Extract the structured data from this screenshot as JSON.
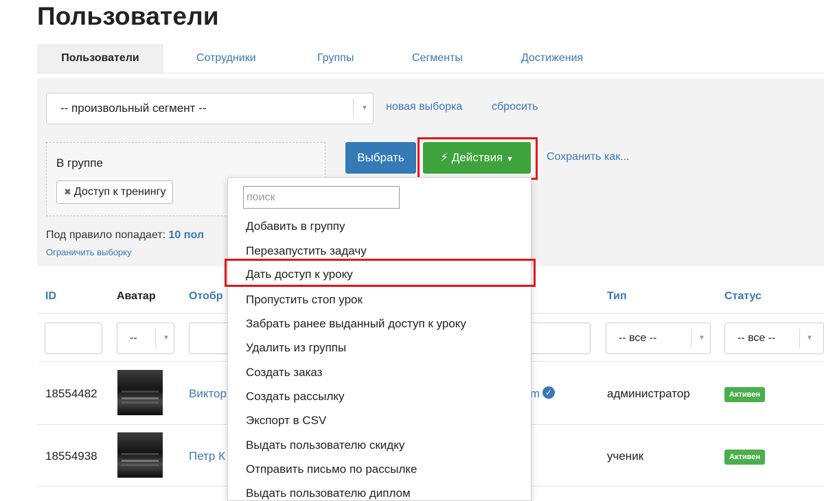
{
  "page_title": "Пользователи",
  "tabs": [
    {
      "label": "Пользователи",
      "active": true
    },
    {
      "label": "Сотрудники"
    },
    {
      "label": "Группы"
    },
    {
      "label": "Сегменты"
    },
    {
      "label": "Достижения"
    }
  ],
  "filter": {
    "segment_value": "-- произвольный сегмент --",
    "new_selection": "новая выборка",
    "reset": "сбросить",
    "group_label": "В группе",
    "group_tag": "Доступ к тренингу",
    "select_button": "Выбрать",
    "actions_button": "Действия",
    "save_as": "Сохранить как...",
    "rule_prefix": "Под правило попадает: ",
    "rule_count": "10 пол",
    "limit_link": "Ограничить выборку"
  },
  "table": {
    "headers": {
      "id": "ID",
      "avatar": "Аватар",
      "display": "Отобр",
      "type": "Тип",
      "status": "Статус"
    },
    "filters": {
      "avatar": "--",
      "type": "-- все --",
      "status": "-- все --"
    },
    "rows": [
      {
        "id": "18554482",
        "name": "Виктор",
        "email_tail": "m",
        "type": "администратор",
        "status": "Активен"
      },
      {
        "id": "18554938",
        "name": "Петр К",
        "type": "ученик",
        "status": "Активен"
      }
    ]
  },
  "dropdown": {
    "search_placeholder": "поиск",
    "items": [
      "Добавить в группу",
      "Перезапустить задачу",
      "Дать доступ к уроку",
      "Пропустить стоп урок",
      "Забрать ранее выданный доступ к уроку",
      "Удалить из группы",
      "Создать заказ",
      "Создать рассылку",
      "Экспорт в CSV",
      "Выдать пользователю скидку",
      "Отправить письмо по рассылке",
      "Выдать пользователю диплом"
    ],
    "highlighted_item": "Дать доступ к уроку"
  },
  "colors": {
    "link": "#3a78b8",
    "primary_button": "#337ab7",
    "actions_button": "#3ea33c",
    "status_badge": "#4cae4c",
    "highlight": "#e4141b"
  },
  "icons": {
    "actions": "lightning-icon",
    "actions_caret": "caret-down-icon",
    "tag_remove": "close-icon",
    "verified": "check-circle-icon",
    "select_caret": "chevron-down-icon"
  }
}
